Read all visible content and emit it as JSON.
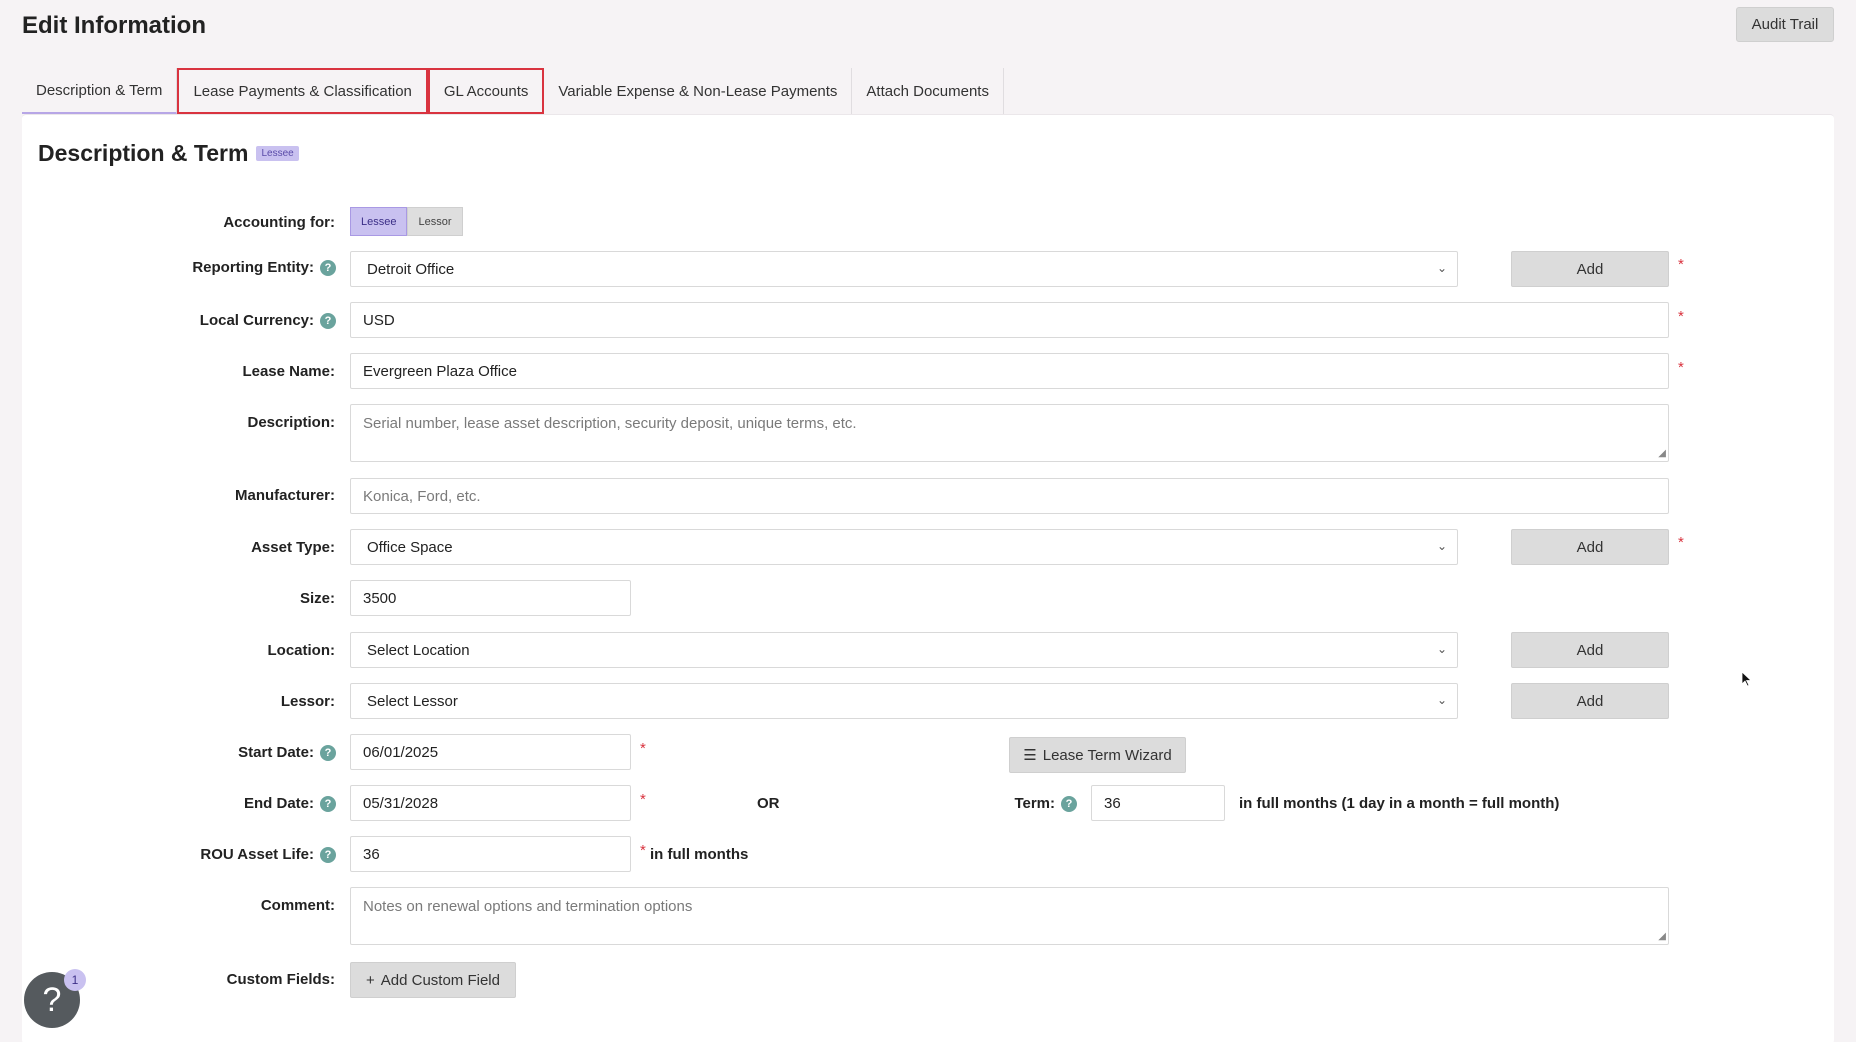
{
  "header": {
    "title": "Edit Information",
    "audit_trail_label": "Audit Trail"
  },
  "tabs": [
    {
      "label": "Description & Term"
    },
    {
      "label": "Lease Payments & Classification"
    },
    {
      "label": "GL Accounts"
    },
    {
      "label": "Variable Expense & Non-Lease Payments"
    },
    {
      "label": "Attach Documents"
    }
  ],
  "section": {
    "title": "Description & Term",
    "badge": "Lessee"
  },
  "accounting_for": {
    "label": "Accounting for:",
    "options": [
      "Lessee",
      "Lessor"
    ],
    "selected": "Lessee"
  },
  "form": {
    "reporting_entity": {
      "label": "Reporting Entity:",
      "value": "Detroit Office"
    },
    "local_currency": {
      "label": "Local Currency:",
      "value": "USD"
    },
    "lease_name": {
      "label": "Lease Name:",
      "value": "Evergreen Plaza Office"
    },
    "description": {
      "label": "Description:",
      "placeholder": "Serial number, lease asset description, security deposit, unique terms, etc."
    },
    "manufacturer": {
      "label": "Manufacturer:",
      "placeholder": "Konica, Ford, etc."
    },
    "asset_type": {
      "label": "Asset Type:",
      "value": "Office Space"
    },
    "size": {
      "label": "Size:",
      "value": "3500"
    },
    "location": {
      "label": "Location:",
      "value": "Select Location"
    },
    "lessor": {
      "label": "Lessor:",
      "value": "Select Lessor"
    },
    "start_date": {
      "label": "Start Date:",
      "value": "06/01/2025"
    },
    "end_date": {
      "label": "End Date:",
      "value": "05/31/2028"
    },
    "or_label": "OR",
    "term": {
      "label": "Term:",
      "value": "36",
      "suffix": "in full months (1 day in a month = full month)"
    },
    "rou_asset_life": {
      "label": "ROU Asset Life:",
      "value": "36",
      "suffix": "in full months"
    },
    "comment": {
      "label": "Comment:",
      "placeholder": "Notes on renewal options and termination options"
    },
    "custom_fields": {
      "label": "Custom Fields:",
      "button": "Add Custom Field"
    }
  },
  "buttons": {
    "add": "Add",
    "lease_term_wizard": "Lease Term Wizard"
  },
  "required_mark": "*",
  "help_widget": {
    "icon": "?",
    "count": "1"
  },
  "colors": {
    "accent": "#c9c1f0",
    "required": "#d9333f",
    "help_icon": "#6aa39d",
    "tab_flag": "#d9333f"
  }
}
